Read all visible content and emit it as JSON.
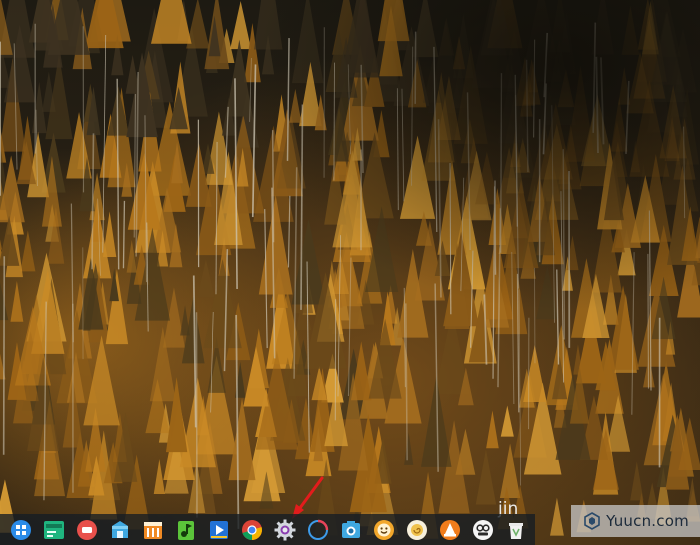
{
  "dock": {
    "items": [
      {
        "name": "launcher-icon",
        "color": "#2b8ce8"
      },
      {
        "name": "terminal-icon",
        "color": "#1fb57f"
      },
      {
        "name": "screen-recorder-icon",
        "color": "#e8504b"
      },
      {
        "name": "app-store-icon",
        "color": "#3fa8e0"
      },
      {
        "name": "file-manager-icon",
        "color": "#f08a24"
      },
      {
        "name": "music-icon",
        "color": "#5bc43a"
      },
      {
        "name": "video-player-icon",
        "color": "#2272d6"
      },
      {
        "name": "chrome-icon",
        "color": "#db4437"
      },
      {
        "name": "settings-gear-icon",
        "color": "#d4d8de"
      },
      {
        "name": "loading-spinner-icon",
        "color": "#3d9be9"
      },
      {
        "name": "screenshot-icon",
        "color": "#3fa8e0"
      },
      {
        "name": "smiley-app-icon",
        "color": "#f2a72b"
      },
      {
        "name": "snail-app-icon",
        "color": "#f0c24d"
      },
      {
        "name": "vlc-icon",
        "color": "#f07c1c"
      },
      {
        "name": "deepin-store-icon",
        "color": "#ffffff"
      },
      {
        "name": "trash-icon",
        "color": "#6fb26a"
      }
    ]
  },
  "tray": {
    "text": "jin"
  },
  "watermark": {
    "text": "Yuucn.com"
  },
  "annotation": {
    "arrow_color": "#e21c1c"
  }
}
